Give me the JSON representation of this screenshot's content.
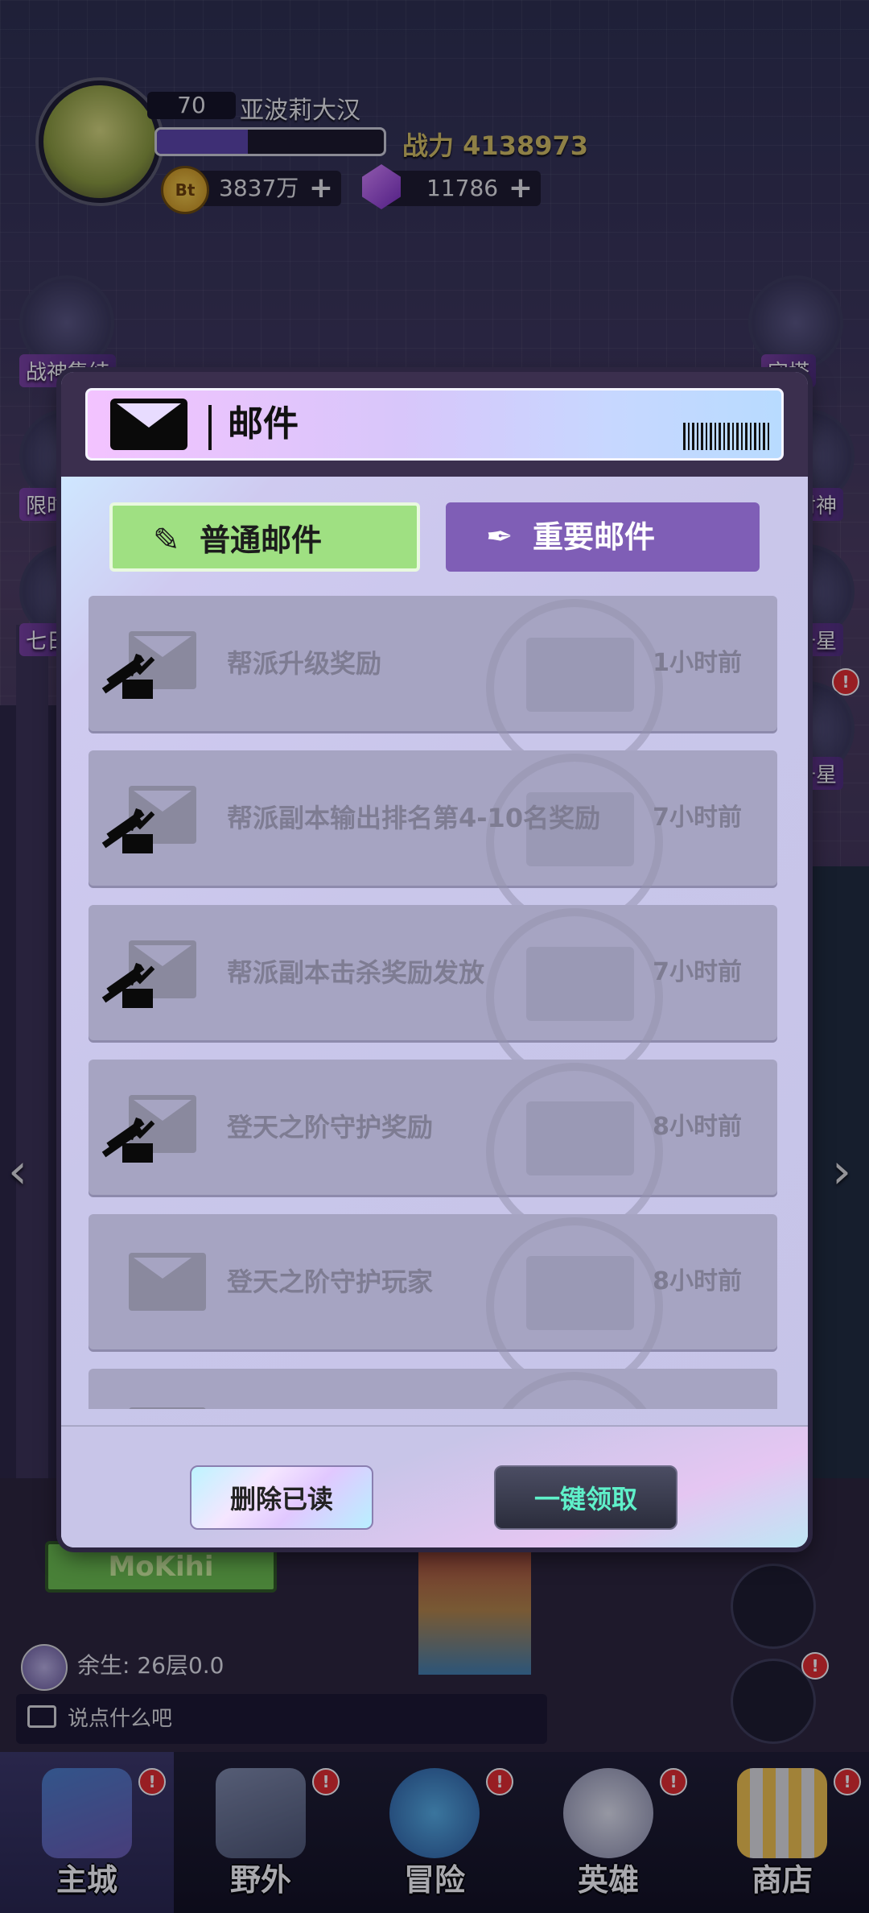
{
  "player": {
    "level": "70",
    "name": "亚波莉大汉",
    "power_label": "战力 4138973",
    "exp_fraction": 0.4,
    "gold_icon_text": "Bt",
    "gold": "3837万",
    "gems": "11786",
    "plus": "+"
  },
  "side_left": [
    {
      "label": "战神集结"
    },
    {
      "label": "限时"
    },
    {
      "label": "七日"
    }
  ],
  "side_right": [
    {
      "label": "守塔"
    },
    {
      "label": "封神"
    },
    {
      "label": "升星"
    },
    {
      "label": "升星"
    }
  ],
  "mail": {
    "title": "邮件",
    "tabs": {
      "normal": "普通邮件",
      "important": "重要邮件"
    },
    "items": [
      {
        "subject": "帮派升级奖励",
        "time": "1小时前",
        "has_attachment": true
      },
      {
        "subject": "帮派副本输出排名第4-10名奖励",
        "time": "7小时前",
        "has_attachment": true
      },
      {
        "subject": "帮派副本击杀奖励发放",
        "time": "7小时前",
        "has_attachment": true
      },
      {
        "subject": "登天之阶守护奖励",
        "time": "8小时前",
        "has_attachment": true
      },
      {
        "subject": "登天之阶守护玩家",
        "time": "8小时前",
        "has_attachment": false
      },
      {
        "subject": "",
        "time": "",
        "has_attachment": false
      }
    ],
    "delete_read": "删除已读",
    "claim_all": "一键领取"
  },
  "status_line": "余生: 26层0.0",
  "chat_placeholder": "说点什么吧",
  "shop_sign": "MoKihi",
  "nav": [
    {
      "label": "主城",
      "active": true
    },
    {
      "label": "野外",
      "active": false
    },
    {
      "label": "冒险",
      "active": false
    },
    {
      "label": "英雄",
      "active": false
    },
    {
      "label": "商店",
      "active": false
    }
  ],
  "badge": "!",
  "colors": {
    "tab_active": "#9fe082",
    "tab_inactive": "#7f5eb6",
    "claim_text": "#5ff0c9",
    "power": "#d6c060"
  }
}
